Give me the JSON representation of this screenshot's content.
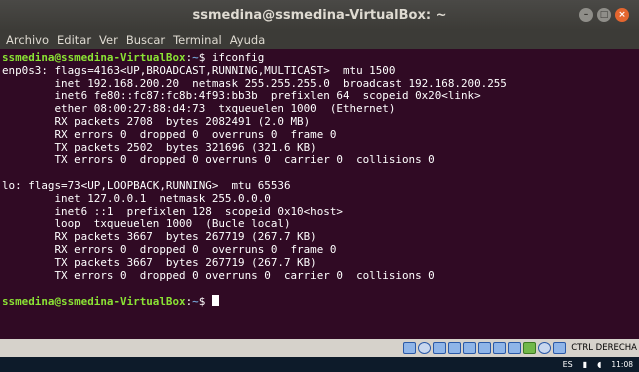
{
  "window": {
    "title": "ssmedina@ssmedina-VirtualBox: ~",
    "controls": [
      "minimize-icon",
      "maximize-icon",
      "close-icon"
    ]
  },
  "menu": [
    "Archivo",
    "Editar",
    "Ver",
    "Buscar",
    "Terminal",
    "Ayuda"
  ],
  "terminal": {
    "prompt_user": "ssmedina@ssmedina-VirtualBox",
    "prompt_sep": ":",
    "prompt_path": "~",
    "prompt_symbol": "$ ",
    "command": "ifconfig",
    "output": [
      "enp0s3: flags=4163<UP,BROADCAST,RUNNING,MULTICAST>  mtu 1500",
      "        inet 192.168.200.20  netmask 255.255.255.0  broadcast 192.168.200.255",
      "        inet6 fe80::fc87:fc8b:4f93:bb3b  prefixlen 64  scopeid 0x20<link>",
      "        ether 08:00:27:88:d4:73  txqueuelen 1000  (Ethernet)",
      "        RX packets 2708  bytes 2082491 (2.0 MB)",
      "        RX errors 0  dropped 0  overruns 0  frame 0",
      "        TX packets 2502  bytes 321696 (321.6 KB)",
      "        TX errors 0  dropped 0 overruns 0  carrier 0  collisions 0",
      "",
      "lo: flags=73<UP,LOOPBACK,RUNNING>  mtu 65536",
      "        inet 127.0.0.1  netmask 255.0.0.0",
      "        inet6 ::1  prefixlen 128  scopeid 0x10<host>",
      "        loop  txqueuelen 1000  (Bucle local)",
      "        RX packets 3667  bytes 267719 (267.7 KB)",
      "        RX errors 0  dropped 0  overruns 0  frame 0",
      "        TX packets 3667  bytes 267719 (267.7 KB)",
      "        TX errors 0  dropped 0 overruns 0  carrier 0  collisions 0",
      ""
    ]
  },
  "vbox_status": {
    "icons": [
      "hard-disk-icon",
      "optical-drive-icon",
      "audio-icon",
      "network-icon",
      "usb-icon",
      "shared-folder-icon",
      "display-icon",
      "recording-icon",
      "cpu-icon",
      "mouse-integration-icon",
      "host-key-icon"
    ],
    "host_key": "CTRL DERECHA"
  },
  "taskbar": {
    "language": "ES",
    "time": "11:08"
  },
  "colors": {
    "terminal_bg": "#300a24",
    "prompt_user": "#8ae234",
    "prompt_path": "#729fcf",
    "close_button": "#e4662f"
  }
}
